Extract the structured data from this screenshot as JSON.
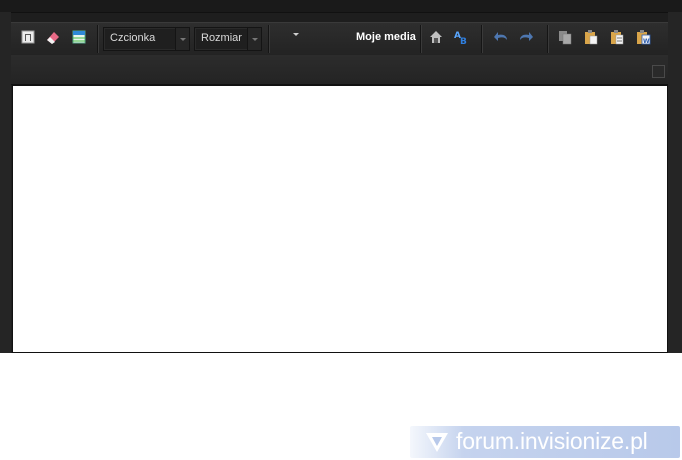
{
  "toolbar": {
    "font_select": {
      "value": "Czcionka"
    },
    "size_select": {
      "value": "Rozmiar"
    },
    "media_button": {
      "label": "Moje media"
    },
    "icons": [
      "show-source-icon",
      "remove-format-icon",
      "table-icon",
      "home-icon",
      "spellcheck-icon",
      "undo-icon",
      "redo-icon",
      "copy-icon",
      "paste-icon",
      "paste-text-icon",
      "paste-word-icon"
    ]
  },
  "editor": {
    "content": ""
  },
  "watermark": {
    "text": "forum.invisionize.pl"
  },
  "colors": {
    "frame": "#1e1e1e",
    "toolbar": "#2a2a2a",
    "edit_area": "#ffffff",
    "watermark_bg": "#c0cfee"
  }
}
